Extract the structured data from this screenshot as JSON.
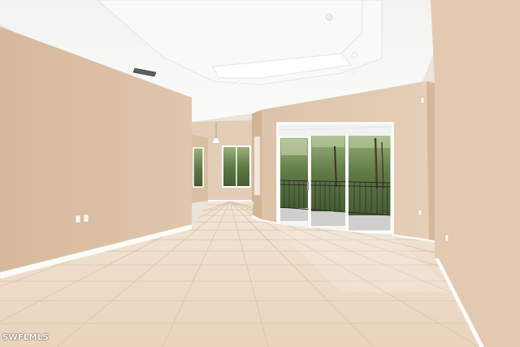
{
  "watermark": {
    "text": "SWFLMLS"
  },
  "colors": {
    "wall": "#dcc2a7",
    "wall_shadow": "#cfb195",
    "ceiling": "#f6f6f4",
    "floor_tile": "#ecd9c4",
    "grout": "#dcc7b0",
    "baseboard": "#fbfbf8",
    "glass_green": "#5f7a45",
    "railing": "#2b2b2b"
  },
  "icons": [
    "ceiling-light-icon",
    "pendant-light-icon",
    "air-vent-icon",
    "electrical-outlet-icon",
    "smoke-detector-icon"
  ]
}
